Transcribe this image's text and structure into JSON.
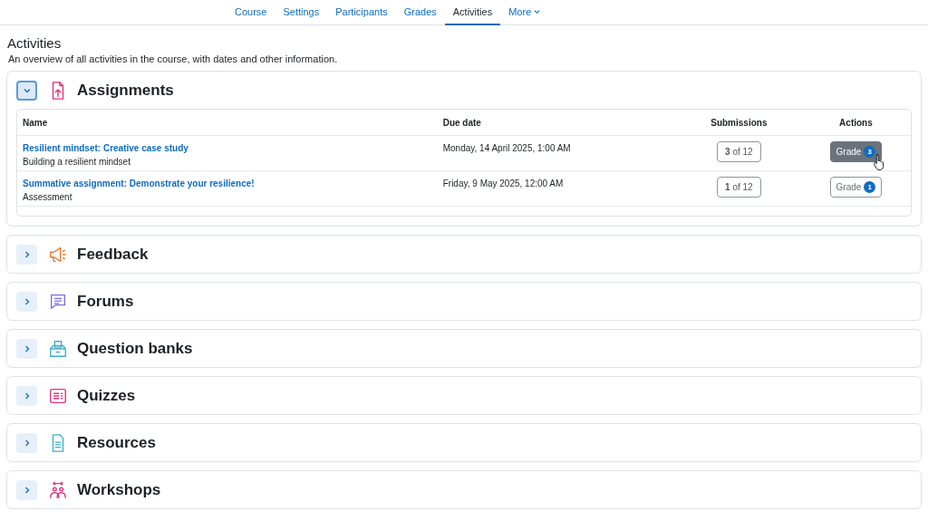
{
  "nav": {
    "tabs": [
      {
        "label": "Course",
        "selected": false
      },
      {
        "label": "Settings",
        "selected": false
      },
      {
        "label": "Participants",
        "selected": false
      },
      {
        "label": "Grades",
        "selected": false
      },
      {
        "label": "Activities",
        "selected": true
      },
      {
        "label": "More",
        "selected": false,
        "kind": "dropdown"
      }
    ]
  },
  "page": {
    "title": "Activities",
    "description": "An overview of all activities in the course, with dates and other information."
  },
  "sections": [
    {
      "title": "Assignments",
      "kind": "assignment",
      "expanded": true,
      "table": {
        "columns": [
          "Name",
          "Due date",
          "Submissions",
          "Actions"
        ],
        "rows": [
          {
            "name": "Resilient mindset: Creative case study",
            "section": "Building a resilient mindset",
            "due": "Monday, 14 April 2025, 1:00 AM",
            "submissions": "**3** of 12",
            "action": "Grade",
            "badge": "3",
            "kind": "hovered"
          },
          {
            "name": "Summative assignment: Demonstrate your resilience!",
            "section": "Assessment",
            "due": "Friday, 9 May 2025, 12:00 AM",
            "submissions": "**1** of 12",
            "action": "Grade",
            "badge": "1",
            "kind": "plain"
          }
        ]
      }
    },
    {
      "title": "Feedback",
      "kind": "feedback",
      "expanded": false
    },
    {
      "title": "Forums",
      "kind": "forum",
      "expanded": false
    },
    {
      "title": "Question banks",
      "kind": "qbank",
      "expanded": false
    },
    {
      "title": "Quizzes",
      "kind": "quiz",
      "expanded": false
    },
    {
      "title": "Resources",
      "kind": "resource",
      "expanded": false
    },
    {
      "title": "Workshops",
      "kind": "workshop",
      "expanded": false
    }
  ]
}
